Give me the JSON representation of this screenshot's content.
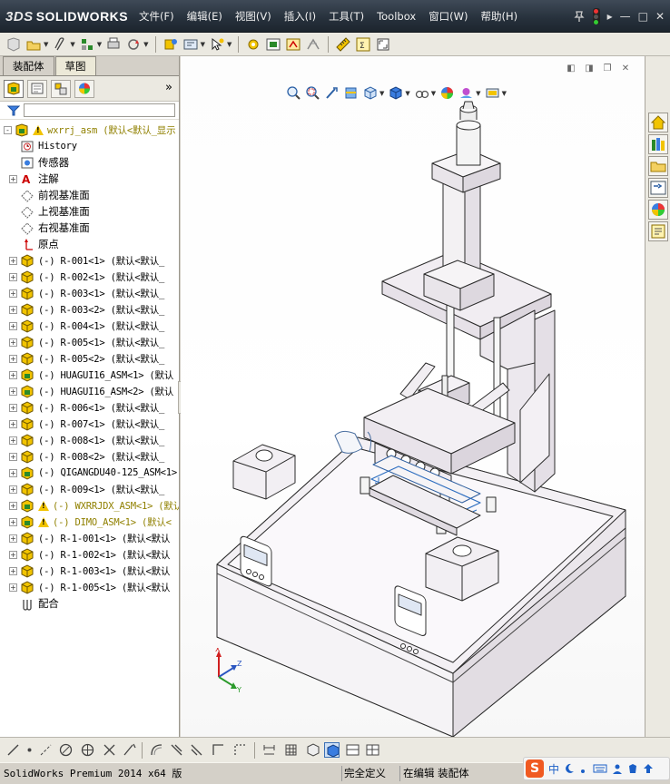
{
  "app": {
    "brand_prefix": "3DS",
    "brand": "SOLIDWORKS",
    "menu": [
      "文件(F)",
      "编辑(E)",
      "视图(V)",
      "插入(I)",
      "工具(T)",
      "Toolbox",
      "窗口(W)",
      "帮助(H)"
    ],
    "title_right_arrow": "▸",
    "window_buttons": [
      "—",
      "□",
      "✕"
    ]
  },
  "left_panel": {
    "tabs": [
      "装配体",
      "草图"
    ],
    "more": "»",
    "tree": [
      {
        "label": "wxrrj_asm  (默认<默认_显示",
        "kind": "root",
        "expand": "-",
        "warn": true,
        "olive": true
      },
      {
        "label": "History",
        "kind": "history",
        "expand": ""
      },
      {
        "label": "传感器",
        "kind": "sensor",
        "expand": ""
      },
      {
        "label": "注解",
        "kind": "annot",
        "expand": "+"
      },
      {
        "label": "前视基准面",
        "kind": "plane",
        "expand": ""
      },
      {
        "label": "上视基准面",
        "kind": "plane",
        "expand": ""
      },
      {
        "label": "右视基准面",
        "kind": "plane",
        "expand": ""
      },
      {
        "label": "原点",
        "kind": "origin",
        "expand": ""
      },
      {
        "label": "(-) R-001<1> (默认<默认_",
        "kind": "part",
        "expand": "+"
      },
      {
        "label": "(-) R-002<1> (默认<默认_",
        "kind": "part",
        "expand": "+"
      },
      {
        "label": "(-) R-003<1> (默认<默认_",
        "kind": "part",
        "expand": "+"
      },
      {
        "label": "(-) R-003<2> (默认<默认_",
        "kind": "part",
        "expand": "+"
      },
      {
        "label": "(-) R-004<1> (默认<默认_",
        "kind": "part",
        "expand": "+"
      },
      {
        "label": "(-) R-005<1> (默认<默认_",
        "kind": "part",
        "expand": "+"
      },
      {
        "label": "(-) R-005<2> (默认<默认_",
        "kind": "part",
        "expand": "+"
      },
      {
        "label": "(-) HUAGUI16_ASM<1> (默认",
        "kind": "asm",
        "expand": "+"
      },
      {
        "label": "(-) HUAGUI16_ASM<2> (默认",
        "kind": "asm",
        "expand": "+"
      },
      {
        "label": "(-) R-006<1> (默认<默认_",
        "kind": "part",
        "expand": "+"
      },
      {
        "label": "(-) R-007<1> (默认<默认_",
        "kind": "part",
        "expand": "+"
      },
      {
        "label": "(-) R-008<1> (默认<默认_",
        "kind": "part",
        "expand": "+"
      },
      {
        "label": "(-) R-008<2> (默认<默认_",
        "kind": "part",
        "expand": "+"
      },
      {
        "label": "(-) QIGANGDU40-125_ASM<1>",
        "kind": "asm",
        "expand": "+"
      },
      {
        "label": "(-) R-009<1> (默认<默认_",
        "kind": "part",
        "expand": "+"
      },
      {
        "label": "(-) WXRRJDX_ASM<1> (默认",
        "kind": "asm",
        "expand": "+",
        "warn": true,
        "olive": true
      },
      {
        "label": "(-) DIMO_ASM<1> (默认<",
        "kind": "asm",
        "expand": "+",
        "warn": true,
        "olive": true
      },
      {
        "label": "(-) R-1-001<1> (默认<默认",
        "kind": "part",
        "expand": "+"
      },
      {
        "label": "(-) R-1-002<1> (默认<默认",
        "kind": "part",
        "expand": "+"
      },
      {
        "label": "(-) R-1-003<1> (默认<默认",
        "kind": "part",
        "expand": "+"
      },
      {
        "label": "(-) R-1-005<1> (默认<默认",
        "kind": "part",
        "expand": "+"
      },
      {
        "label": "配合",
        "kind": "mates",
        "expand": ""
      }
    ]
  },
  "viewport": {
    "triad": {
      "x": "X",
      "y": "Y",
      "z": "Z"
    }
  },
  "statusbar": {
    "product": "SolidWorks Premium 2014 x64 版",
    "definition": "完全定义",
    "editing": "在编辑 装配体"
  },
  "ime": {
    "logo": "S",
    "mode": "中"
  },
  "colors": {
    "titlebar": "#26303b",
    "part_yellow": "#e8c400",
    "model_body": "#f2eef2",
    "model_edge": "#2b2b2b",
    "accent_blue": "#1b5fc7"
  }
}
